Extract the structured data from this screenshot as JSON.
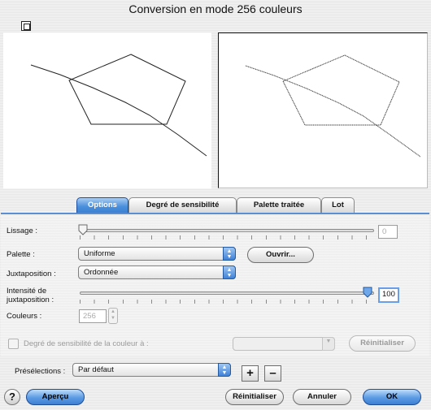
{
  "window": {
    "title": "Conversion en mode 256 couleurs"
  },
  "tabs": [
    {
      "label": "Options",
      "active": true
    },
    {
      "label": "Degré de sensibilité",
      "active": false
    },
    {
      "label": "Palette traitée",
      "active": false
    },
    {
      "label": "Lot",
      "active": false
    }
  ],
  "options": {
    "smoothing": {
      "label": "Lissage :",
      "value": "0",
      "level": 0
    },
    "palette": {
      "label": "Palette :",
      "selected": "Uniforme",
      "open_button": "Ouvrir..."
    },
    "dithering": {
      "label": "Juxtaposition :",
      "selected": "Ordonnée"
    },
    "dither_intensity": {
      "label": "Intensité de juxtaposition :",
      "value": "100",
      "level": 100
    },
    "colors": {
      "label": "Couleurs :",
      "value": "256"
    },
    "sensitivity": {
      "label": "Degré de sensibilité de la couleur à :",
      "selected": "",
      "reset_button": "Réinitialiser"
    }
  },
  "presets": {
    "label": "Présélections :",
    "selected": "Par défaut",
    "add": "+",
    "remove": "–"
  },
  "footer": {
    "help": "?",
    "preview": "Aperçu",
    "reset": "Réinitialiser",
    "cancel": "Annuler",
    "ok": "OK"
  },
  "colors": {
    "accent": "#3d7fd4",
    "tab_active": "#4a8fdc"
  },
  "icons": {
    "preview_toggle": "preview-toggle-icon",
    "popup_arrow": "updown-arrows-icon"
  }
}
